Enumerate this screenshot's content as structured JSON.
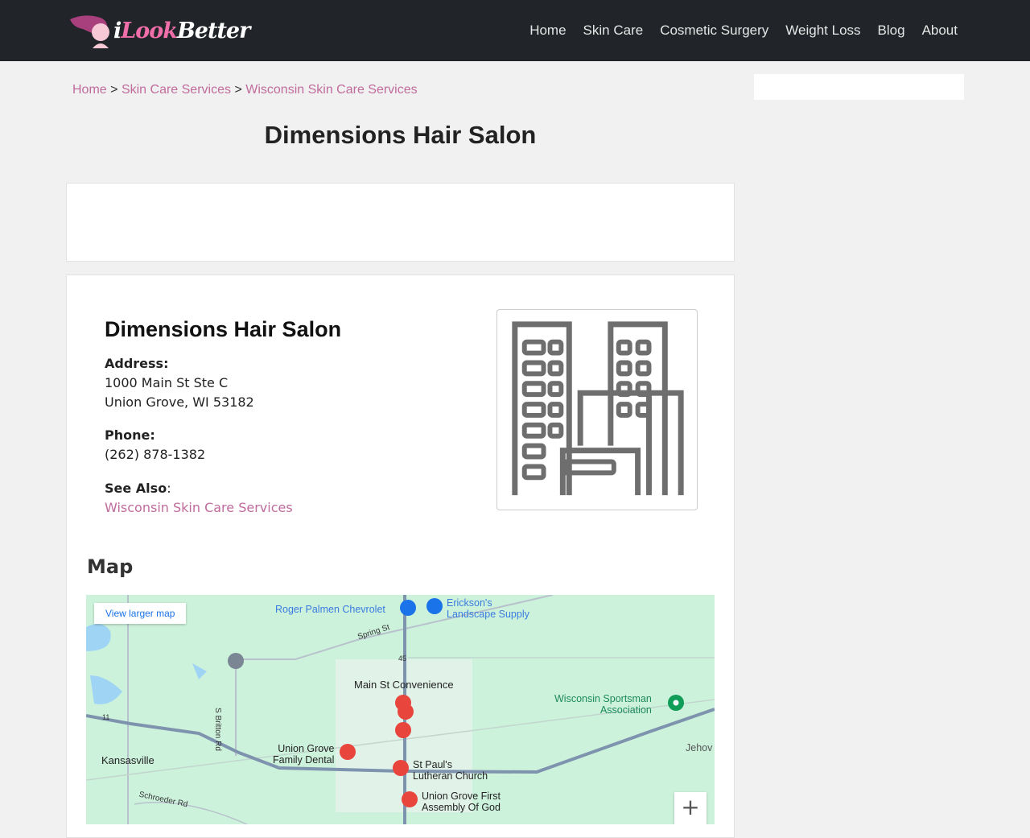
{
  "header": {
    "logo_text_1": "i",
    "logo_text_2": "Look",
    "logo_text_3": "Better",
    "nav": [
      "Home",
      "Skin Care",
      "Cosmetic Surgery",
      "Weight Loss",
      "Blog",
      "About"
    ]
  },
  "breadcrumb": {
    "items": [
      "Home",
      "Skin Care Services",
      "Wisconsin Skin Care Services"
    ],
    "sep": ">"
  },
  "page_title": "Dimensions Hair Salon",
  "business": {
    "name": "Dimensions Hair Salon",
    "address_label": "Address:",
    "address_line1": "1000 Main St Ste C",
    "address_line2": "Union Grove, WI 53182",
    "phone_label": "Phone:",
    "phone": "(262) 878-1382",
    "see_also_label": "See Also",
    "see_also_colon": ":",
    "see_also_link": "Wisconsin Skin Care Services",
    "image_icon": "buildings-icon"
  },
  "map": {
    "heading": "Map",
    "view_larger": "View larger map",
    "zoom_in": "+",
    "labels": {
      "roger": "Roger Palmen Chevrolet",
      "erickson1": "Erickson's",
      "erickson2": "Landscape Supply",
      "spring": "Spring St",
      "main_st": "Main St Convenience",
      "wsa1": "Wisconsin Sportsman",
      "wsa2": "Association",
      "jehov": "Jehov",
      "britton": "S Britton Rd",
      "kansasville": "Kansasville",
      "dental1": "Union Grove",
      "dental2": "Family Dental",
      "stpauls1": "St Paul's",
      "stpauls2": "Lutheran Church",
      "ugf1": "Union Grove First",
      "ugf2": "Assembly Of God",
      "schroeder": "Schroeder Rd",
      "r11": "11",
      "r45": "45"
    }
  },
  "colors": {
    "topbar": "#212529",
    "accent": "#c06c9c",
    "map_bg": "#cdf2dc",
    "marker_red": "#e8453c"
  }
}
